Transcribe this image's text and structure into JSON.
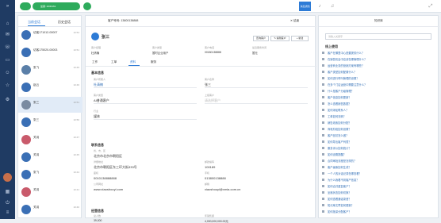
{
  "topbar": {
    "agent_label": "坐席: 2030161",
    "tag": "消息通知"
  },
  "sessions": {
    "tab_current": "当前会话",
    "tab_history": "历史会话",
    "items": [
      {
        "name": "访客171012-00007",
        "time": "10:54",
        "last": ""
      },
      {
        "name": "访客175020-00003",
        "time": "10:51",
        "last": ""
      },
      {
        "name": "张飞",
        "time": "10:49",
        "last": ""
      },
      {
        "name": "赵云",
        "time": "10:46",
        "last": ""
      },
      {
        "name": "张三",
        "time": "10:51",
        "last": ""
      },
      {
        "name": "张三",
        "time": "10:50",
        "last": ""
      },
      {
        "name": "关羽",
        "time": "10:47",
        "last": ""
      },
      {
        "name": "关羽",
        "time": "10:45",
        "last": ""
      },
      {
        "name": "张飞",
        "time": "10:44",
        "last": ""
      },
      {
        "name": "关羽",
        "time": "10:41",
        "last": ""
      },
      {
        "name": "关羽",
        "time": "10:40",
        "last": ""
      }
    ]
  },
  "customer": {
    "phone_label": "客户号码: 13800138888",
    "close": "✕ 结束",
    "name": "张三",
    "btn_check": "查询客户",
    "btn_edit": "✎ 编辑客户",
    "btn_new": "+ 新建",
    "info_labels": [
      "客户经理",
      "客户类型",
      "客户电话",
      "最近服务时间"
    ],
    "info_values": [
      "杜清楠",
      "暂时企业用户",
      "00180138888",
      "暂无"
    ],
    "tabs": [
      "工作",
      "工单",
      "资料",
      "服务"
    ],
    "sec_basic": "基本信息",
    "basic": [
      {
        "label": "客户所属人",
        "value": "杜清楠"
      },
      {
        "label": "客户名称",
        "value": "张三"
      },
      {
        "label": "客户类型",
        "value": "AI普通客户"
      },
      {
        "label": "上级客户",
        "value": "请选择客户"
      },
      {
        "label": "行业",
        "value": "媒体"
      }
    ],
    "sec_contact": "联系信息",
    "contact": [
      {
        "label": "省、市、区",
        "value": "北京市北京市朝阳区"
      },
      {
        "label": "详细地址",
        "value": "北京市朝阳区东三环大街333号"
      },
      {
        "label": "邮政编码",
        "value": "100189"
      },
      {
        "label": "座机",
        "value": "0010138888888"
      },
      {
        "label": "手机",
        "value": "013800138888"
      },
      {
        "label": "公司网址",
        "value": "www.xiaoshouyi.com"
      },
      {
        "label": "邮箱",
        "value": "xiaoshouyi@xmia.com.cn"
      }
    ],
    "sec_business": "经营信息",
    "business": [
      {
        "label": "总人数",
        "value": "39,000"
      },
      {
        "label": "年销售额",
        "value": "4,000,000,000.00元"
      }
    ]
  },
  "kb": {
    "title": "知识库",
    "search_placeholder": "请输入关键字",
    "section": "线上使用",
    "items": [
      "客户在哪里中心是要提供什么？",
      "在销售机会中应该在哪管理什么？",
      "运营商业务的营销方案有哪些？",
      "客户类型如何配置什么？",
      "如何进行呼叫管理的设置？",
      "在多个门店运营中需要注意什么？",
      "什么是客户分级管理？",
      "客户信息如何更新？",
      "怎么查看销售数据？",
      "如何添加联系人？",
      "工单如何流转？",
      "销售线索如何分配？",
      "商机阶段如何设置？",
      "客户回访怎么做？",
      "如何导出客户列表？",
      "服务评价如何统计？",
      "如何设置提醒？",
      "合同审批流程是怎样的？",
      "客户画像如何生成？",
      "一个人的对话记录在哪查看？",
      "为什么我看不到客户信息？",
      "如何合并重复客户？",
      "坐席状态如何切换？",
      "如何查看通话录音？",
      "知识库文章如何更新？",
      "如何批量分配客户？"
    ]
  }
}
